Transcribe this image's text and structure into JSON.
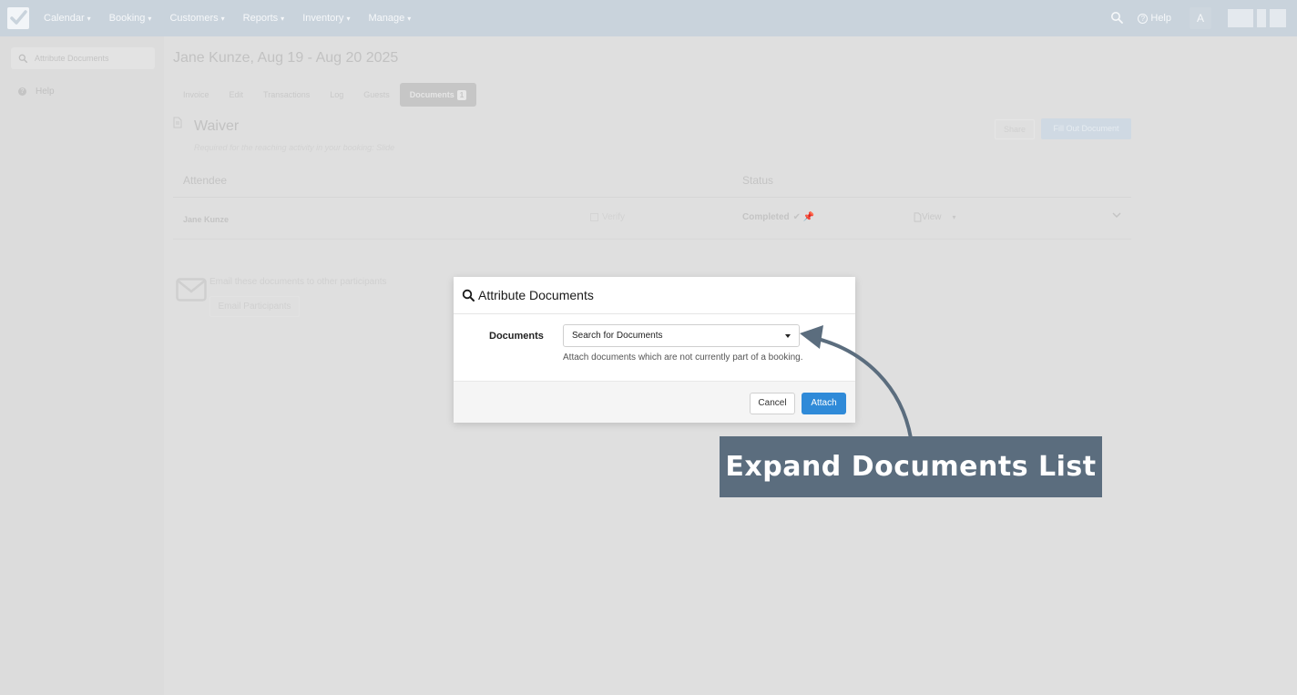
{
  "nav": {
    "menu": [
      {
        "label": "Calendar"
      },
      {
        "label": "Booking"
      },
      {
        "label": "Customers"
      },
      {
        "label": "Reports"
      },
      {
        "label": "Inventory"
      },
      {
        "label": "Manage"
      }
    ],
    "caret": "▾",
    "help_label": "Help",
    "avatar_initial": "A",
    "icons": {
      "logo": "checkmark-logo-icon",
      "search": "search-icon",
      "help": "question-circle-icon"
    }
  },
  "sidebar": {
    "search_placeholder": "Attribute Documents",
    "help_label": "Help"
  },
  "booking": {
    "title": "Jane Kunze, Aug 19 - Aug 20 2025",
    "tabs": [
      {
        "label": "Invoice"
      },
      {
        "label": "Edit"
      },
      {
        "label": "Transactions"
      },
      {
        "label": "Log"
      },
      {
        "label": "Guests"
      },
      {
        "label": "Documents",
        "badge": "1",
        "active": true
      }
    ]
  },
  "document": {
    "title": "Waiver",
    "subtitle": "Required for the reaching activity in your booking: Slide",
    "share_label": "Share",
    "fill_label": "Fill Out Document",
    "columns": {
      "attendee": "Attendee",
      "status": "Status"
    },
    "row": {
      "name": "Jane Kunze",
      "verify_label": "Verify",
      "status": "Completed",
      "status_marks": "✔ 📌",
      "view_label": "View"
    }
  },
  "email": {
    "text": "Email these documents to other participants",
    "button_label": "Email Participants"
  },
  "modal": {
    "title": "Attribute Documents",
    "field_label": "Documents",
    "select_placeholder": "Search for Documents",
    "help_text": "Attach documents which are not currently part of a booking.",
    "cancel_label": "Cancel",
    "attach_label": "Attach"
  },
  "callout": {
    "text": "Expand Documents List"
  },
  "colors": {
    "nav_bg": "#c9d3dc",
    "overlay_bg": "#dfdfdf",
    "primary_button": "#2f8ad8",
    "callout_bg": "#5b6d7e",
    "arrow": "#5b6d7e"
  }
}
